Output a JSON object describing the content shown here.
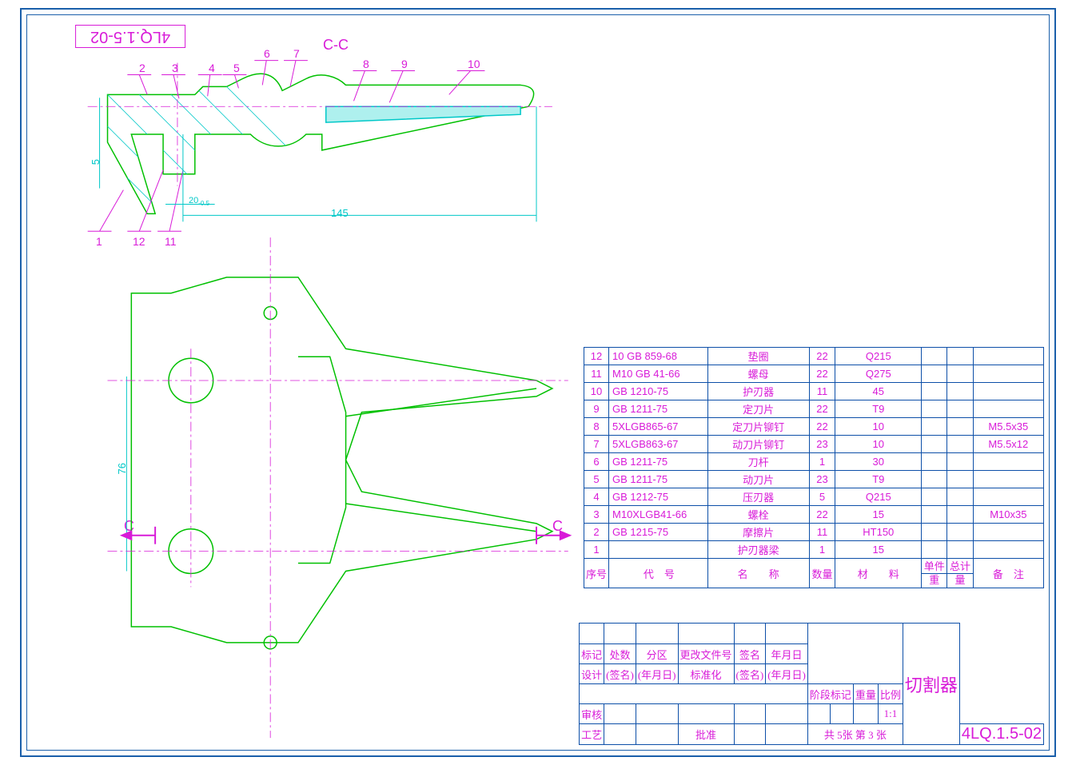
{
  "drawing": {
    "section_label": "C-C",
    "flipped_partno": "4LQ.1.5-02",
    "callouts_top": [
      "2",
      "3",
      "4",
      "5",
      "6",
      "7",
      "8",
      "9",
      "10"
    ],
    "callouts_bottom": [
      "1",
      "12",
      "11"
    ],
    "dimensions": {
      "dim_145": "145",
      "dim_20": "20",
      "dim_5": "5",
      "dim_76": "76"
    },
    "cut_letters": [
      "C",
      "C"
    ]
  },
  "bom": {
    "header": {
      "idx": "序号",
      "code": "代　号",
      "name": "名　　称",
      "qty": "数量",
      "material": "材　　料",
      "unit_weight": "单件",
      "total_weight": "总计",
      "weight_label": "重　量",
      "note": "备　注"
    },
    "rows": [
      {
        "idx": "12",
        "code": "10 GB 859-68",
        "name": "垫圈",
        "qty": "22",
        "material": "Q215",
        "wu": "",
        "wt": "",
        "note": ""
      },
      {
        "idx": "11",
        "code": "M10 GB 41-66",
        "name": "螺母",
        "qty": "22",
        "material": "Q275",
        "wu": "",
        "wt": "",
        "note": ""
      },
      {
        "idx": "10",
        "code": "GB 1210-75",
        "name": "护刃器",
        "qty": "11",
        "material": "45",
        "wu": "",
        "wt": "",
        "note": ""
      },
      {
        "idx": "9",
        "code": "GB 1211-75",
        "name": "定刀片",
        "qty": "22",
        "material": "T9",
        "wu": "",
        "wt": "",
        "note": ""
      },
      {
        "idx": "8",
        "code": "5XLGB865-67",
        "name": "定刀片铆钉",
        "qty": "22",
        "material": "10",
        "wu": "",
        "wt": "",
        "note": "M5.5x35"
      },
      {
        "idx": "7",
        "code": "5XLGB863-67",
        "name": "动刀片铆钉",
        "qty": "23",
        "material": "10",
        "wu": "",
        "wt": "",
        "note": "M5.5x12"
      },
      {
        "idx": "6",
        "code": "GB 1211-75",
        "name": "刀杆",
        "qty": "1",
        "material": "30",
        "wu": "",
        "wt": "",
        "note": ""
      },
      {
        "idx": "5",
        "code": "GB 1211-75",
        "name": "动刀片",
        "qty": "23",
        "material": "T9",
        "wu": "",
        "wt": "",
        "note": ""
      },
      {
        "idx": "4",
        "code": "GB 1212-75",
        "name": "压刃器",
        "qty": "5",
        "material": "Q215",
        "wu": "",
        "wt": "",
        "note": ""
      },
      {
        "idx": "3",
        "code": "M10XLGB41-66",
        "name": "螺栓",
        "qty": "22",
        "material": "15",
        "wu": "",
        "wt": "",
        "note": "M10x35"
      },
      {
        "idx": "2",
        "code": "GB 1215-75",
        "name": "摩擦片",
        "qty": "11",
        "material": "HT150",
        "wu": "",
        "wt": "",
        "note": ""
      },
      {
        "idx": "1",
        "code": "",
        "name": "护刃器梁",
        "qty": "1",
        "material": "15",
        "wu": "",
        "wt": "",
        "note": ""
      }
    ]
  },
  "title": {
    "row_labels": {
      "mark": "标记",
      "count": "处数",
      "zone": "分区",
      "change": "更改文件号",
      "sign": "签名",
      "date": "年月日",
      "design": "设计",
      "sign2": "(签名)",
      "date2": "(年月日)",
      "std": "标准化",
      "sign3": "(签名)",
      "date3": "(年月日)",
      "review": "审核",
      "process": "工艺",
      "approve": "批准",
      "stage": "阶段标记",
      "weight": "重量",
      "scale": "比例"
    },
    "scale_value": "1:1",
    "sheets": "共 5张 第 3 张",
    "title_name": "切割器",
    "drawing_no": "4LQ.1.5-02"
  }
}
